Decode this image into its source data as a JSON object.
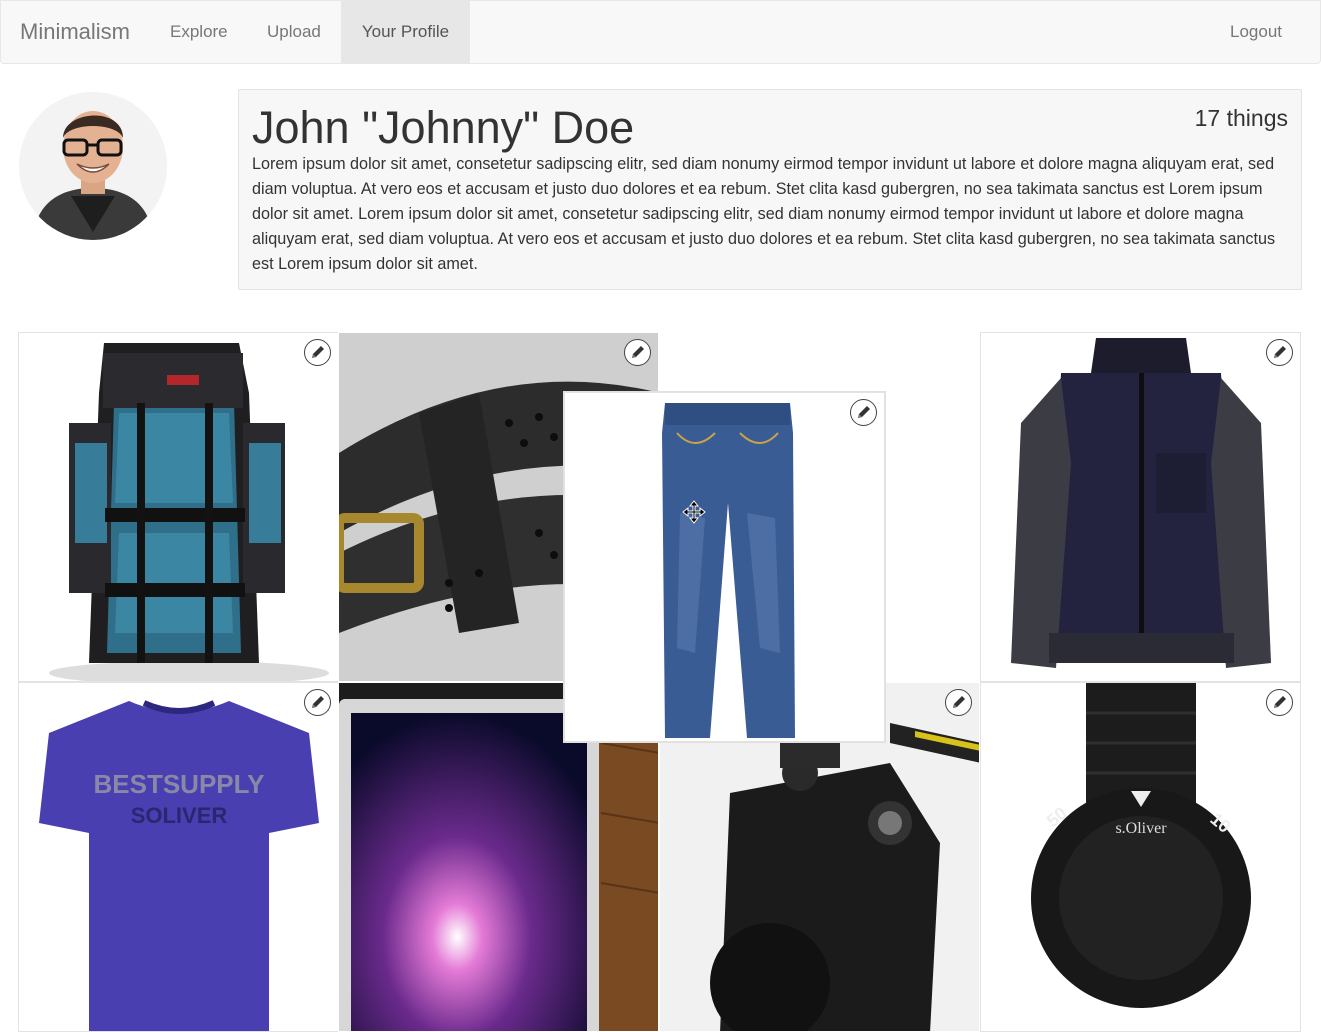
{
  "navbar": {
    "brand": "Minimalism",
    "links": [
      {
        "label": "Explore",
        "active": false
      },
      {
        "label": "Upload",
        "active": false
      },
      {
        "label": "Your Profile",
        "active": true
      }
    ],
    "logout_label": "Logout"
  },
  "profile": {
    "name": "John \"Johnny\" Doe",
    "thing_count": "17 things",
    "bio": "Lorem ipsum dolor sit amet, consetetur sadipscing elitr, sed diam nonumy eirmod tempor invidunt ut labore et dolore magna aliquyam erat, sed diam voluptua. At vero eos et accusam et justo duo dolores et ea rebum. Stet clita kasd gubergren, no sea takimata sanctus est Lorem ipsum dolor sit amet. Lorem ipsum dolor sit amet, consetetur sadipscing elitr, sed diam nonumy eirmod tempor invidunt ut labore et dolore magna aliquyam erat, sed diam voluptua. At vero eos et accusam et justo duo dolores et ea rebum. Stet clita kasd gubergren, no sea takimata sanctus est Lorem ipsum dolor sit amet."
  },
  "items": [
    {
      "name": "backpack",
      "icon": "pencil-icon"
    },
    {
      "name": "belt",
      "icon": "pencil-icon"
    },
    {
      "name": "jeans",
      "icon": "pencil-icon",
      "dragging": true
    },
    {
      "name": "jacket",
      "icon": "pencil-icon"
    },
    {
      "name": "t-shirt",
      "icon": "pencil-icon"
    },
    {
      "name": "laptop",
      "icon": "pencil-icon"
    },
    {
      "name": "camera",
      "icon": "pencil-icon"
    },
    {
      "name": "watch",
      "icon": "pencil-icon"
    }
  ],
  "colors": {
    "navbar_bg": "#f8f8f8",
    "navbar_active_bg": "#e7e7e7",
    "panel_bg": "#f7f7f7",
    "text": "#333333",
    "nav_text": "#777777"
  }
}
